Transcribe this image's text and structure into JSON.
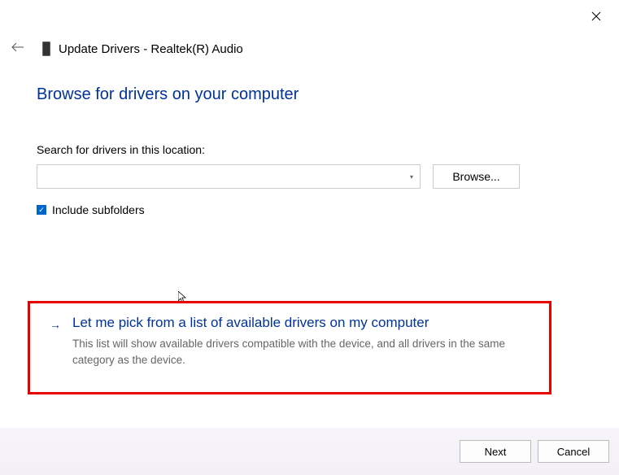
{
  "window": {
    "title": "Update Drivers - Realtek(R) Audio"
  },
  "main": {
    "heading": "Browse for drivers on your computer",
    "search_label": "Search for drivers in this location:",
    "path_value": "",
    "browse_label": "Browse...",
    "include_subfolders_label": "Include subfolders",
    "include_subfolders_checked": true
  },
  "option": {
    "title": "Let me pick from a list of available drivers on my computer",
    "description": "This list will show available drivers compatible with the device, and all drivers in the same category as the device."
  },
  "footer": {
    "next_label": "Next",
    "cancel_label": "Cancel"
  }
}
